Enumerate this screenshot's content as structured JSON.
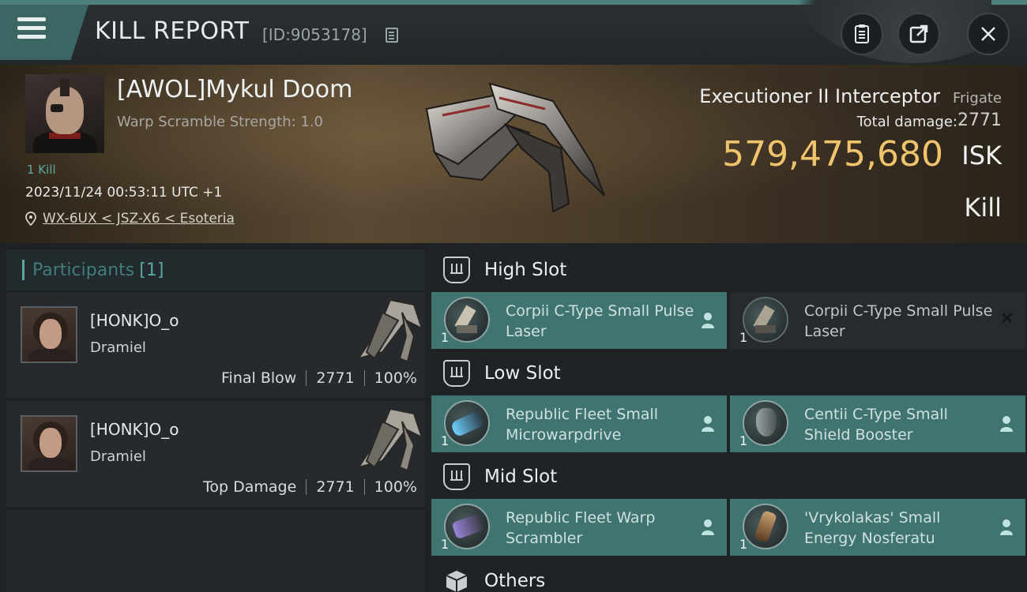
{
  "header": {
    "title": "KILL REPORT",
    "kill_id": "[ID:9053178]",
    "buttons": [
      "clipboard-icon",
      "share-icon",
      "close-icon"
    ]
  },
  "victim": {
    "name": "[AWOL]Mykul Doom",
    "warp_scramble": "Warp Scramble Strength: 1.0",
    "kills": "1 Kill",
    "date": "2023/11/24 00:53:11 UTC +1",
    "location": "WX-6UX < JSZ-X6 < Esoteria"
  },
  "ship": {
    "name": "Executioner II Interceptor",
    "class": "Frigate",
    "total_damage_label": "Total damage:",
    "total_damage": "2771",
    "isk_value": "579,475,680",
    "isk_unit": "ISK",
    "status": "Kill"
  },
  "participants": {
    "label": "Participants",
    "count": "[1]",
    "items": [
      {
        "name": "[HONK]O_o",
        "ship": "Dramiel",
        "role": "Final Blow",
        "damage": "2771",
        "percent": "100%"
      },
      {
        "name": "[HONK]O_o",
        "ship": "Dramiel",
        "role": "Top Damage",
        "damage": "2771",
        "percent": "100%"
      }
    ]
  },
  "slots": {
    "high": {
      "title": "High Slot",
      "modules": [
        {
          "name": "Corpii C-Type Small Pulse Laser",
          "qty": "1",
          "icon": "laser-icon",
          "state": "fitted"
        },
        {
          "name": "Corpii C-Type Small Pulse Laser",
          "qty": "1",
          "icon": "laser-icon",
          "state": "destroyed"
        }
      ]
    },
    "low": {
      "title": "Low Slot",
      "modules": [
        {
          "name": "Republic Fleet Small Microwarpdrive",
          "qty": "1",
          "icon": "microwarpdrive-icon",
          "state": "fitted"
        },
        {
          "name": "Centii C-Type Small Shield Booster",
          "qty": "1",
          "icon": "shield-booster-icon",
          "state": "fitted"
        }
      ]
    },
    "mid": {
      "title": "Mid Slot",
      "modules": [
        {
          "name": "Republic Fleet Warp Scrambler",
          "qty": "1",
          "icon": "warp-scrambler-icon",
          "state": "fitted"
        },
        {
          "name": "'Vrykolakas' Small Energy Nosferatu",
          "qty": "1",
          "icon": "nosferatu-icon",
          "state": "fitted"
        }
      ]
    },
    "others": {
      "title": "Others"
    }
  },
  "colors": {
    "accent_teal": "#3f7470",
    "isk_gold": "#f0c46c",
    "header_teal": "#3c6664"
  }
}
